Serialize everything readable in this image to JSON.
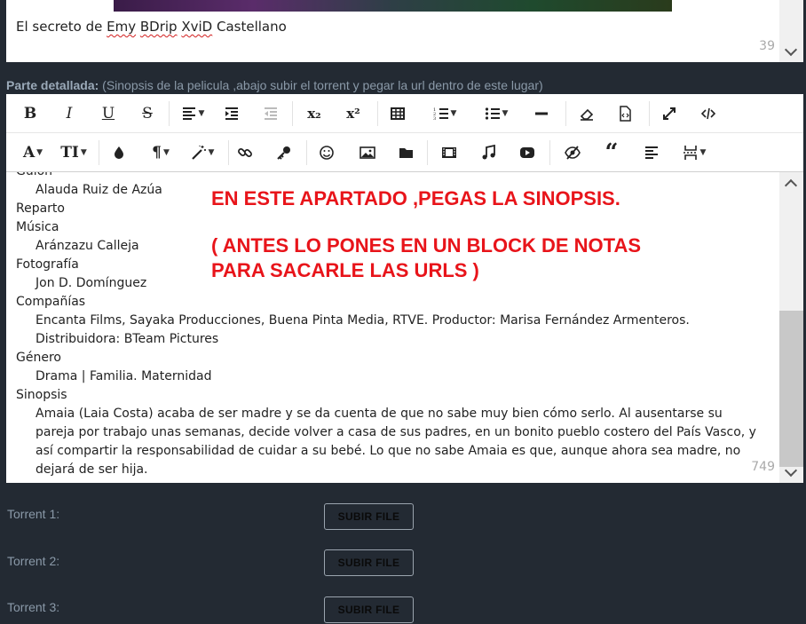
{
  "title_box": {
    "text_parts": [
      "El secreto de ",
      "Emy",
      " ",
      "BDrip",
      " ",
      "XviD",
      " Castellano"
    ],
    "counter": "39"
  },
  "section": {
    "label_bold": "Parte detallada:",
    "label_hint": " (Sinopsis de la pelicula ,abajo subir el torrent y pegar la url dentro de este lugar)"
  },
  "toolbar": {
    "row1": [
      "bold-icon",
      "italic-icon",
      "underline-icon",
      "strikethrough-icon",
      "align-icon",
      "indent-icon",
      "outdent-icon",
      "subscript-icon",
      "superscript-icon",
      "table-icon",
      "ordered-list-icon",
      "unordered-list-icon",
      "horizontal-rule-icon",
      "eraser-icon",
      "code-file-icon",
      "fullscreen-icon",
      "source-code-icon"
    ],
    "row2": [
      "font-icon",
      "font-size-icon",
      "color-drop-icon",
      "paragraph-icon",
      "magic-wand-icon",
      "link-icon",
      "key-icon",
      "smiley-icon",
      "image-icon",
      "folder-icon",
      "video-icon",
      "music-icon",
      "youtube-icon",
      "hide-icon",
      "quote-icon",
      "align-left-icon",
      "page-break-icon"
    ],
    "labels": {
      "bold": "B",
      "italic": "I",
      "underline": "U",
      "strike": "S",
      "sub": "x₂",
      "sup": "x²",
      "font": "A",
      "size": "TI",
      "para": "¶"
    }
  },
  "editor": {
    "lines": [
      {
        "t": "Guión",
        "cut": true
      },
      {
        "t": "Alauda Ruiz de Azúa",
        "ind": true
      },
      {
        "t": "Reparto"
      },
      {
        "t": "Música"
      },
      {
        "t": "Aránzazu Calleja",
        "ind": true
      },
      {
        "t": "Fotografía"
      },
      {
        "t": "Jon D. Domínguez",
        "ind": true
      },
      {
        "t": "Compañías"
      },
      {
        "t": "Encanta Films, Sayaka Producciones, Buena Pinta Media, RTVE. Productor: Marisa Fernández Armenteros. Distribuidora: BTeam Pictures",
        "ind": true
      },
      {
        "t": "Género"
      },
      {
        "t": "Drama | Familia. Maternidad",
        "ind": true
      },
      {
        "t": "Sinopsis"
      },
      {
        "t": "Amaia (Laia Costa) acaba de ser madre y se da cuenta de que no sabe muy bien cómo serlo. Al ausentarse su pareja por trabajo unas semanas, decide volver a casa de sus padres, en un bonito pueblo costero del País Vasco, y así compartir la responsabilidad de cuidar a su bebé. Lo que no sabe Amaia es que, aunque ahora sea madre, no dejará de ser hija.",
        "ind": true
      }
    ],
    "note_line1": "EN ESTE APARTADO ,PEGAS LA SINOPSIS.",
    "note_line2": "( ANTES LO PONES EN UN BLOCK DE NOTAS",
    "note_line3": "PARA SACARLE LAS URLS )",
    "counter": "749"
  },
  "torrents": [
    {
      "label": "Torrent 1:",
      "button": "SUBIR FILE"
    },
    {
      "label": "Torrent 2:",
      "button": "SUBIR FILE"
    },
    {
      "label": "Torrent 3:",
      "button": "SUBIR FILE"
    }
  ],
  "colors": {
    "background": "#232a33",
    "note": "#e8141a",
    "label": "#8a99a8"
  }
}
